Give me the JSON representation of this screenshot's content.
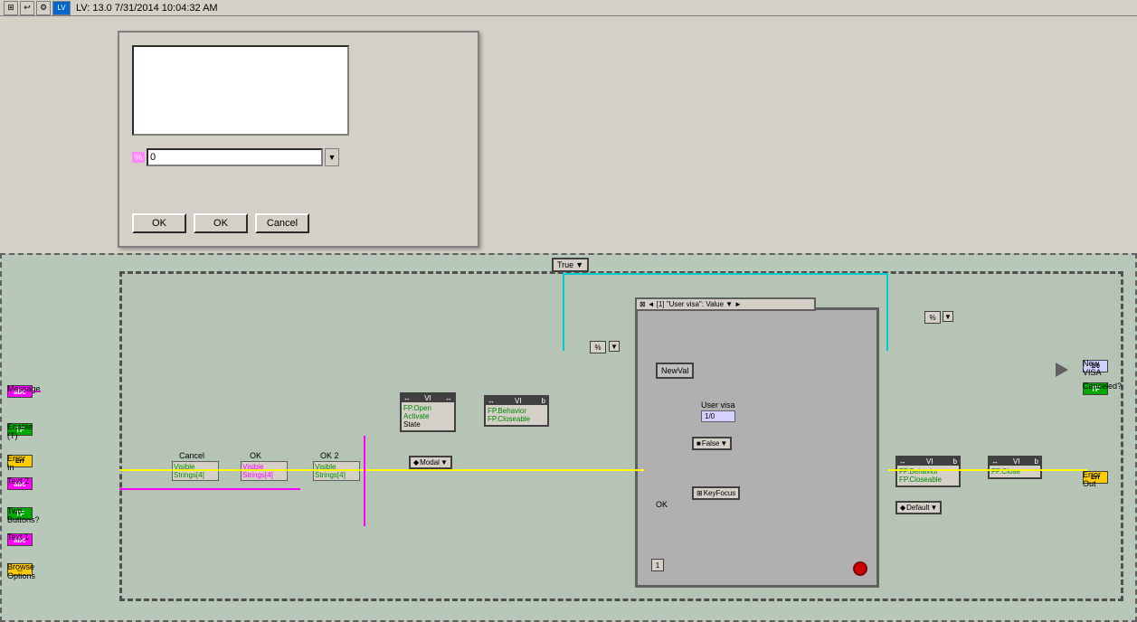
{
  "titlebar": {
    "text": "LV: 13.0 7/31/2014 10:04:32 AM"
  },
  "dialog": {
    "ok_button1": "OK",
    "ok_button2": "OK",
    "cancel_button": "Cancel",
    "input_placeholder": "0"
  },
  "diagram": {
    "case_selector": "True",
    "case_dropdown": "▼",
    "inner_node_label": "[1] \"User visa\": Value",
    "newval_label": "NewVal",
    "user_visa_label": "User visa",
    "user_visa_value": "1/0",
    "false_label": "False",
    "false_dropdown": "▼",
    "ok_label": "OK",
    "keyfocus_label": "KeyFocus",
    "new_visa_label": "New VISA",
    "canceled_label": "Canceled?",
    "error_out_label": "Error Out",
    "left_labels": {
      "message": "Message",
      "enable_t": "Enable (T)",
      "error_in": "Error In",
      "text2": "Text 2",
      "two_buttons": "Two Buttons?",
      "text1": "Text 1",
      "browse_options": "Browse Options"
    },
    "vi_blocks": {
      "vi1_open": "FP.Open",
      "vi1_activate": "Activate",
      "vi1_state": "State",
      "vi1_modal": "Modal",
      "vi2_fp_behavior": "FP.Behavior",
      "vi2_fp_closeable": "FP.Closeable",
      "vi3_fp_behavior": "FP.Behavior",
      "vi3_fp_closeable": "FP.Closeable",
      "vi3_default": "Default",
      "vi4_fp_close": "FP.Close",
      "cancel_label": "Cancel",
      "ok_col_label": "OK",
      "ok2_label": "OK 2",
      "visible1": "Visible",
      "strings1": "Strings[4]",
      "visible2": "Visible",
      "strings2": "Strings[4]",
      "visible3": "Visible",
      "strings3": "Strings[4]"
    }
  }
}
